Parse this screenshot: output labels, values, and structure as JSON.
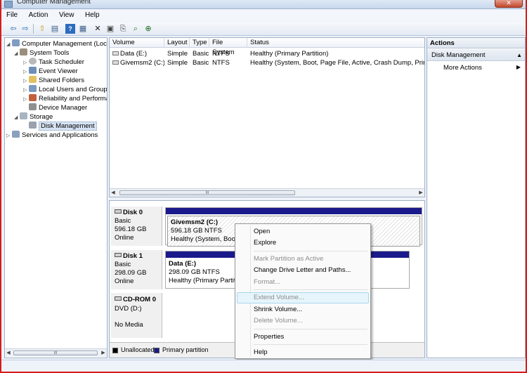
{
  "window": {
    "title": "Computer Management",
    "close_label": "✕"
  },
  "menu": [
    "File",
    "Action",
    "View",
    "Help"
  ],
  "toolbar": {
    "icons": [
      "back-arrow-icon",
      "forward-arrow-icon",
      "up-folder-icon",
      "show-hide-tree-icon",
      "help-icon",
      "console-tree-icon",
      "delete-icon",
      "properties-icon",
      "export-icon",
      "search-icon",
      "magnify-icon"
    ],
    "glyphs": [
      "⇦",
      "⇨",
      "⇧",
      "▤",
      "?",
      "▦",
      "✕",
      "▣",
      "⎘",
      "⌕",
      "⊕"
    ]
  },
  "tree": {
    "root": "Computer Management (Local",
    "items": [
      {
        "label": "System Tools",
        "expander": "◢"
      },
      {
        "label": "Task Scheduler",
        "expander": "▷"
      },
      {
        "label": "Event Viewer",
        "expander": "▷"
      },
      {
        "label": "Shared Folders",
        "expander": "▷"
      },
      {
        "label": "Local Users and Groups",
        "expander": "▷"
      },
      {
        "label": "Reliability and Performa",
        "expander": "▷"
      },
      {
        "label": "Device Manager",
        "expander": ""
      },
      {
        "label": "Storage",
        "expander": "◢"
      },
      {
        "label": "Disk Management",
        "expander": ""
      },
      {
        "label": "Services and Applications",
        "expander": "▷"
      }
    ],
    "root_expander": "◢",
    "scroll_thumb_glyph": "III"
  },
  "volumes": {
    "columns": [
      "Volume",
      "Layout",
      "Type",
      "File System",
      "Status"
    ],
    "rows": [
      [
        "Data (E:)",
        "Simple",
        "Basic",
        "NTFS",
        "Healthy (Primary Partition)"
      ],
      [
        "Givemsm2 (C:)",
        "Simple",
        "Basic",
        "NTFS",
        "Healthy (System, Boot, Page File, Active, Crash Dump, Primary"
      ]
    ],
    "scroll_thumb_glyph": "III"
  },
  "disks": [
    {
      "name": "Disk 0",
      "type": "Basic",
      "size": "596.18 GB",
      "state": "Online",
      "partition": {
        "name": "Givemsm2  (C:)",
        "size": "596.18 GB NTFS",
        "status": "Healthy (System, Boot, P"
      }
    },
    {
      "name": "Disk 1",
      "type": "Basic",
      "size": "298.09 GB",
      "state": "Online",
      "partition": {
        "name": "Data  (E:)",
        "size": "298.09 GB NTFS",
        "status": "Healthy (Primary Partiti"
      }
    },
    {
      "name": "CD-ROM 0",
      "type": "DVD (D:)",
      "size": "",
      "state": "No Media"
    }
  ],
  "legend": [
    {
      "label": "Unallocated",
      "color": "#000000"
    },
    {
      "label": "Primary partition",
      "color": "#1a1a8c"
    }
  ],
  "actions": {
    "header": "Actions",
    "section": "Disk Management",
    "more": "More Actions"
  },
  "context_menu": {
    "items": [
      {
        "label": "Open",
        "enabled": true
      },
      {
        "label": "Explore",
        "enabled": true
      },
      {
        "label": "Mark Partition as Active",
        "enabled": false
      },
      {
        "label": "Change Drive Letter and Paths...",
        "enabled": true
      },
      {
        "label": "Format...",
        "enabled": false
      },
      {
        "label": "Extend Volume...",
        "enabled": false,
        "hovered": true
      },
      {
        "label": "Shrink Volume...",
        "enabled": true
      },
      {
        "label": "Delete Volume...",
        "enabled": false
      },
      {
        "label": "Properties",
        "enabled": true
      },
      {
        "label": "Help",
        "enabled": true
      }
    ]
  },
  "colors": {
    "accent_highlight": "#fffc00",
    "partition_bar": "#1a1a8c",
    "window_border": "#d81b1b"
  }
}
